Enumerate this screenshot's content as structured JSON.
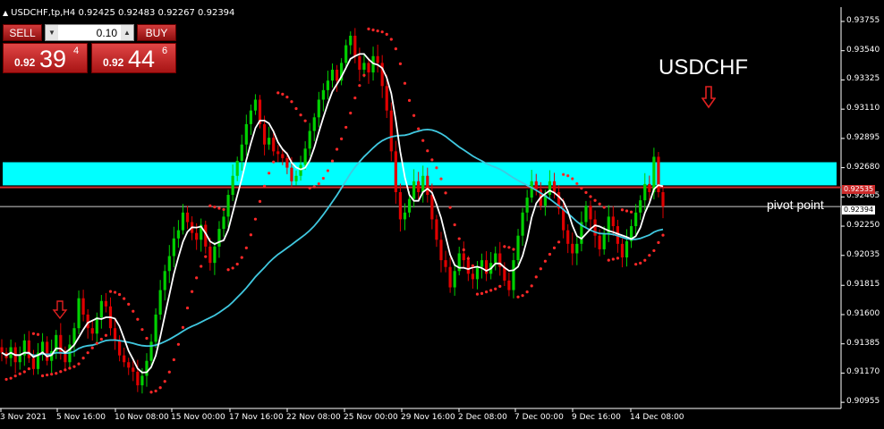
{
  "header": {
    "text": "USDCHF,tp,H4  0.92425 0.92483 0.92267 0.92394"
  },
  "trade_panel": {
    "sell_label": "SELL",
    "buy_label": "BUY",
    "lot_value": "0.10",
    "sell_price_prefix": "0.92",
    "sell_price_big": "39",
    "sell_price_sup": "4",
    "buy_price_prefix": "0.92",
    "buy_price_big": "44",
    "buy_price_sup": "6"
  },
  "annotations": {
    "symbol": "USDCHF",
    "pivot": "pivot point"
  },
  "price_labels": {
    "resistance": "0.92535",
    "bid": "0.92394"
  },
  "colors": {
    "bg": "#000000",
    "bull": "#00d000",
    "bear": "#e00000",
    "sar": "#ff2828",
    "ma_fast": "#ffffff",
    "ma_slow": "#40c8e0",
    "zone": "#00ffff",
    "resistance_line": "#cc2b2b",
    "grid_frame": "#ffffff"
  },
  "chart_data": {
    "type": "candlestick",
    "symbol": "USDCHF",
    "timeframe": "H4",
    "ylim": [
      0.9091,
      0.9386
    ],
    "y_ticks": [
      "0.93755",
      "0.93540",
      "0.93325",
      "0.93110",
      "0.92895",
      "0.92680",
      "0.92465",
      "0.92250",
      "0.92035",
      "0.91815",
      "0.91600",
      "0.91385",
      "0.91170",
      "0.90955"
    ],
    "x_ticks": [
      "3 Nov 2021",
      "5 Nov 16:00",
      "10 Nov 08:00",
      "15 Nov 00:00",
      "17 Nov 16:00",
      "22 Nov 08:00",
      "25 Nov 00:00",
      "29 Nov 16:00",
      "2 Dec 08:00",
      "7 Dec 00:00",
      "9 Dec 16:00",
      "14 Dec 08:00"
    ],
    "ohlc_last": {
      "open": 0.92425,
      "high": 0.92483,
      "low": 0.92267,
      "close": 0.92394
    },
    "price_path": [
      0.9132,
      0.9128,
      0.9136,
      0.9125,
      0.913,
      0.9141,
      0.9128,
      0.912,
      0.9132,
      0.914,
      0.9126,
      0.9133,
      0.9145,
      0.9131,
      0.9125,
      0.9138,
      0.915,
      0.9172,
      0.916,
      0.915,
      0.9146,
      0.9158,
      0.917,
      0.9166,
      0.915,
      0.9141,
      0.913,
      0.9125,
      0.9121,
      0.9118,
      0.9108,
      0.9115,
      0.9126,
      0.914,
      0.916,
      0.9178,
      0.9192,
      0.9203,
      0.9216,
      0.9222,
      0.9235,
      0.9228,
      0.922,
      0.9215,
      0.9226,
      0.921,
      0.9198,
      0.921,
      0.9223,
      0.9232,
      0.9248,
      0.9262,
      0.9273,
      0.9285,
      0.93,
      0.931,
      0.9318,
      0.93,
      0.9285,
      0.929,
      0.928,
      0.9278,
      0.9275,
      0.9268,
      0.9258,
      0.9262,
      0.927,
      0.9282,
      0.9295,
      0.9305,
      0.9318,
      0.9325,
      0.9332,
      0.934,
      0.9332,
      0.9345,
      0.9358,
      0.9365,
      0.935,
      0.934,
      0.9345,
      0.9338,
      0.935,
      0.9345,
      0.9328,
      0.931,
      0.928,
      0.925,
      0.923,
      0.9235,
      0.9245,
      0.9258,
      0.925,
      0.9262,
      0.9248,
      0.923,
      0.9215,
      0.92,
      0.9195,
      0.918,
      0.9192,
      0.9205,
      0.92,
      0.919,
      0.9186,
      0.9195,
      0.92,
      0.919,
      0.9198,
      0.9205,
      0.9195,
      0.9185,
      0.9178,
      0.92,
      0.9218,
      0.9235,
      0.9246,
      0.9258,
      0.9252,
      0.924,
      0.9248,
      0.9258,
      0.925,
      0.9238,
      0.9222,
      0.9212,
      0.9205,
      0.9212,
      0.9228,
      0.924,
      0.923,
      0.9218,
      0.9208,
      0.922,
      0.9232,
      0.9225,
      0.9212,
      0.9202,
      0.9214,
      0.9225,
      0.9235,
      0.9244,
      0.9256,
      0.925,
      0.9276,
      0.925,
      0.92394
    ],
    "zone": {
      "top": 0.9272,
      "bottom": 0.9255
    },
    "resistance_price": 0.92535,
    "bid_price": 0.92394
  }
}
